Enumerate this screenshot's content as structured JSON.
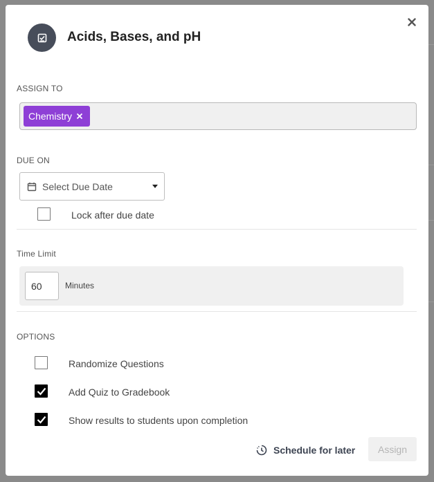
{
  "modal": {
    "title": "Acids, Bases, and pH",
    "close_icon": "close-icon"
  },
  "assign_to": {
    "label": "ASSIGN TO",
    "chips": [
      {
        "label": "Chemistry",
        "color": "#8e3fd6"
      }
    ]
  },
  "due_on": {
    "label": "DUE ON",
    "select_placeholder": "Select Due Date",
    "lock_label": "Lock after due date",
    "lock_checked": false
  },
  "time_limit": {
    "label": "Time Limit",
    "value": "60",
    "unit": "Minutes"
  },
  "options": {
    "label": "OPTIONS",
    "items": [
      {
        "label": "Randomize Questions",
        "checked": false
      },
      {
        "label": "Add Quiz to Gradebook",
        "checked": true
      },
      {
        "label": "Show results to students upon completion",
        "checked": true
      }
    ]
  },
  "footer": {
    "schedule_label": "Schedule for later",
    "assign_label": "Assign"
  }
}
